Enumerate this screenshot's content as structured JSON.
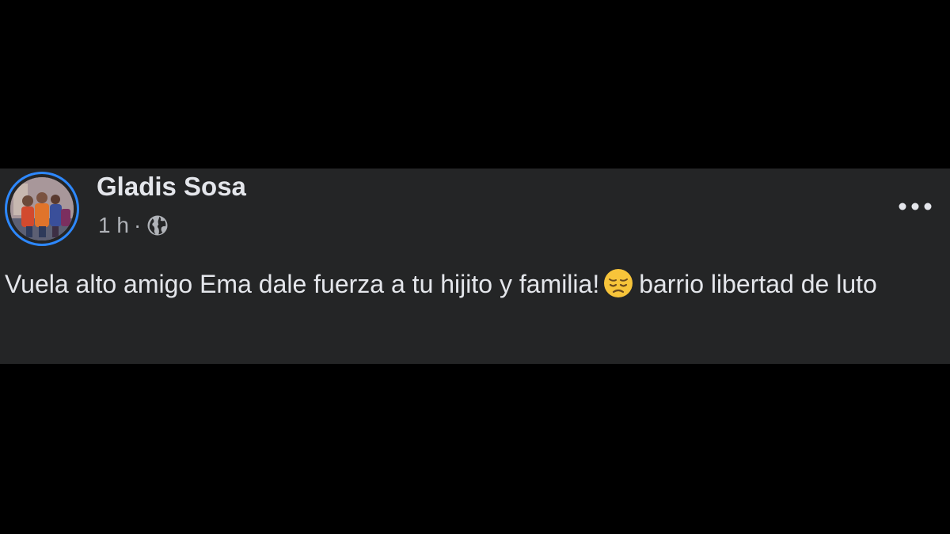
{
  "post": {
    "author": "Gladis Sosa",
    "time": "1 h",
    "separator": "·",
    "privacy_icon": "globe-icon",
    "more_icon": "more-horizontal-icon",
    "text_before_emoji": "Vuela alto amigo Ema dale fuerza a tu hijito y familia!",
    "emoji": "pensive-face",
    "text_after_emoji": "barrio libertad de luto"
  },
  "colors": {
    "background": "#000000",
    "card": "#242526",
    "primary_text": "#e4e6eb",
    "secondary_text": "#b0b3b8",
    "avatar_ring": "#2d88ff"
  }
}
